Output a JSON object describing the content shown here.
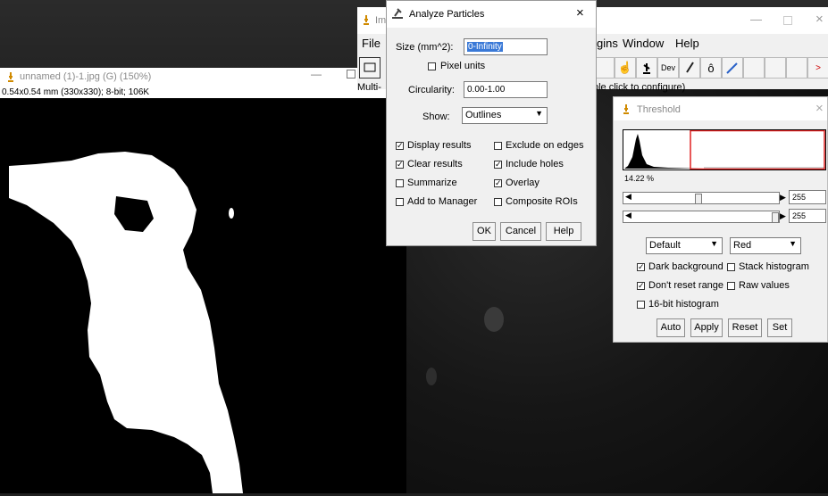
{
  "image_window": {
    "title": "unnamed (1)-1.jpg (G) (150%)",
    "info": "0.54x0.54 mm (330x330); 8-bit; 106K"
  },
  "imagej": {
    "title": "Im",
    "menu": [
      "File",
      "gins",
      "Window",
      "Help"
    ],
    "status": "ble click to configure)",
    "multi_label": "Multi-",
    "tools": [
      "rectangle-icon",
      "hand-icon",
      "tuning-fork-icon",
      "dev-icon",
      "brush-icon",
      "dropper-icon",
      "pencil-icon",
      "arrow-icon"
    ]
  },
  "analyze": {
    "title": "Analyze Particles",
    "size_label": "Size (mm^2):",
    "size_value": "0-Infinity",
    "pixel_units": "Pixel units",
    "circ_label": "Circularity:",
    "circ_value": "0.00-1.00",
    "show_label": "Show:",
    "show_value": "Outlines",
    "checks": {
      "display_results": "Display results",
      "clear_results": "Clear results",
      "summarize": "Summarize",
      "add_to_manager": "Add to Manager",
      "exclude_on_edges": "Exclude on edges",
      "include_holes": "Include holes",
      "overlay": "Overlay",
      "composite_rois": "Composite ROIs"
    },
    "ok": "OK",
    "cancel": "Cancel",
    "help": "Help"
  },
  "threshold": {
    "title": "Threshold",
    "percent": "14.22 %",
    "slider1_value": "255",
    "slider2_value": "255",
    "method": "Default",
    "mode": "Red",
    "dark_background": "Dark background",
    "stack_histogram": "Stack histogram",
    "dont_reset": "Don't reset range",
    "raw_values": "Raw values",
    "bit16": "16-bit histogram",
    "auto": "Auto",
    "apply": "Apply",
    "reset": "Reset",
    "set": "Set"
  },
  "colors": {
    "threshold_red": "#e02020",
    "selection_blue": "#3a79d7"
  }
}
